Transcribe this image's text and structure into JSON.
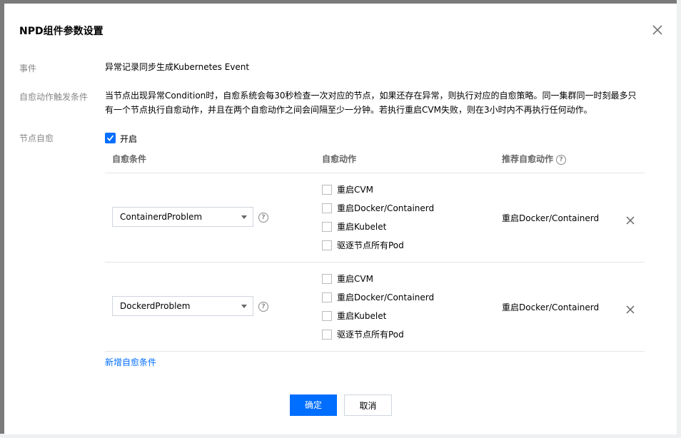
{
  "dialog": {
    "title": "NPD组件参数设置",
    "close_icon": "close-icon"
  },
  "event": {
    "label": "事件",
    "value": "异常记录同步生成Kubernetes Event"
  },
  "trigger": {
    "label": "自愈动作触发条件",
    "value": "当节点出现异常Condition时，自愈系统会每30秒检查一次对应的节点，如果还存在异常，则执行对应的自愈策略。同一集群同一时刻最多只有一个节点执行自愈动作，并且在两个自愈动作之间会间隔至少一分钟。若执行重启CVM失败，则在3小时内不再执行任何动作。"
  },
  "self_heal": {
    "label": "节点自愈",
    "enable_label": "开启",
    "enabled": true,
    "columns": {
      "condition": "自愈条件",
      "action": "自愈动作",
      "recommended": "推荐自愈动作"
    },
    "rules": [
      {
        "condition": "ContainerdProblem",
        "actions": [
          "重启CVM",
          "重启Docker/Containerd",
          "重启Kubelet",
          "驱逐节点所有Pod"
        ],
        "recommended": "重启Docker/Containerd"
      },
      {
        "condition": "DockerdProblem",
        "actions": [
          "重启CVM",
          "重启Docker/Containerd",
          "重启Kubelet",
          "驱逐节点所有Pod"
        ],
        "recommended": "重启Docker/Containerd"
      }
    ],
    "add_label": "新增自愈条件"
  },
  "footer": {
    "ok_label": "确定",
    "cancel_label": "取消"
  },
  "colors": {
    "primary": "#006eff"
  }
}
